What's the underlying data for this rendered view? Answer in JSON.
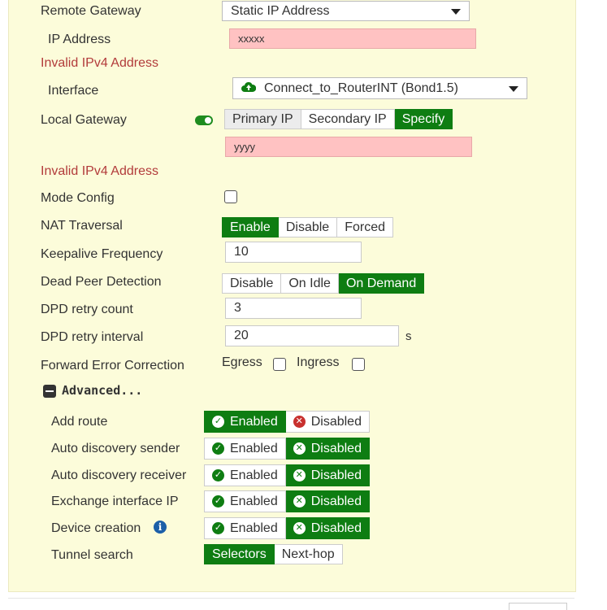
{
  "form": {
    "remote_gateway": {
      "label": "Remote Gateway",
      "value": "Static IP Address"
    },
    "ip_address": {
      "label": "IP Address",
      "value": "xxxxx",
      "error": "Invalid IPv4 Address"
    },
    "interface": {
      "label": "Interface",
      "value": "Connect_to_RouterINT (Bond1.5)"
    },
    "local_gateway": {
      "label": "Local Gateway",
      "enabled": true,
      "options": [
        "Primary IP",
        "Secondary IP",
        "Specify"
      ],
      "selected": "Specify",
      "value": "yyyy",
      "error": "Invalid IPv4 Address"
    },
    "mode_config": {
      "label": "Mode Config",
      "checked": false
    },
    "nat_traversal": {
      "label": "NAT Traversal",
      "options": [
        "Enable",
        "Disable",
        "Forced"
      ],
      "selected": "Enable"
    },
    "keepalive": {
      "label": "Keepalive Frequency",
      "value": "10"
    },
    "dpd": {
      "label": "Dead Peer Detection",
      "options": [
        "Disable",
        "On Idle",
        "On Demand"
      ],
      "selected": "On Demand"
    },
    "dpd_retry_count": {
      "label": "DPD retry count",
      "value": "3"
    },
    "dpd_retry_interval": {
      "label": "DPD retry interval",
      "value": "20",
      "unit": "s"
    },
    "fec": {
      "label": "Forward Error Correction",
      "egress": "Egress",
      "ingress": "Ingress"
    }
  },
  "advanced": {
    "title": "Advanced...",
    "enabled_label": "Enabled",
    "disabled_label": "Disabled",
    "rows": [
      {
        "label": "Add route",
        "selected": "Enabled"
      },
      {
        "label": "Auto discovery sender",
        "selected": "Disabled"
      },
      {
        "label": "Auto discovery receiver",
        "selected": "Disabled"
      },
      {
        "label": "Exchange interface IP",
        "selected": "Disabled"
      },
      {
        "label": "Device creation",
        "selected": "Disabled"
      }
    ],
    "tunnel_search": {
      "label": "Tunnel search",
      "options": [
        "Selectors",
        "Next-hop"
      ],
      "selected": "Selectors"
    }
  },
  "colors": {
    "panel_bg": "#fcfcda",
    "active_green": "#0e7d12",
    "error_red": "#b23b3b",
    "invalid_bg": "#ffc2c2"
  }
}
